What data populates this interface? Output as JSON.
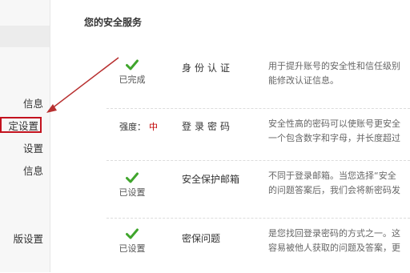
{
  "sidebar": {
    "items": [
      {
        "label": "信息"
      },
      {
        "label": "定设置"
      },
      {
        "label": "设置"
      },
      {
        "label": "信息"
      },
      {
        "label": "版设置"
      }
    ]
  },
  "main": {
    "section_title": "您的安全服务",
    "services": [
      {
        "status": "已完成",
        "name": "身份认证",
        "desc": [
          "用于提升账号的安全性和信任级别",
          "能修改认证信息。"
        ]
      },
      {
        "strength_label": "强度：",
        "strength_level": "中",
        "name": "登录密码",
        "desc": [
          "安全性高的密码可以使账号更安全",
          "一个包含数字和字母，并长度超过"
        ]
      },
      {
        "status": "已设置",
        "name": "安全保护邮箱",
        "desc": [
          "不同于登录邮箱。当您选择“安全",
          "的问题答案后，我们会将新密码发"
        ]
      },
      {
        "status": "已设置",
        "name": "密保问题",
        "desc": [
          "是您找回登录密码的方式之一。这",
          "容易被他人获取的问题及答案，更"
        ]
      }
    ]
  },
  "colors": {
    "highlight_border": "#c3121e",
    "check_green": "#3fa52c",
    "strength_red": "#c00000",
    "arrow": "#b83030"
  }
}
